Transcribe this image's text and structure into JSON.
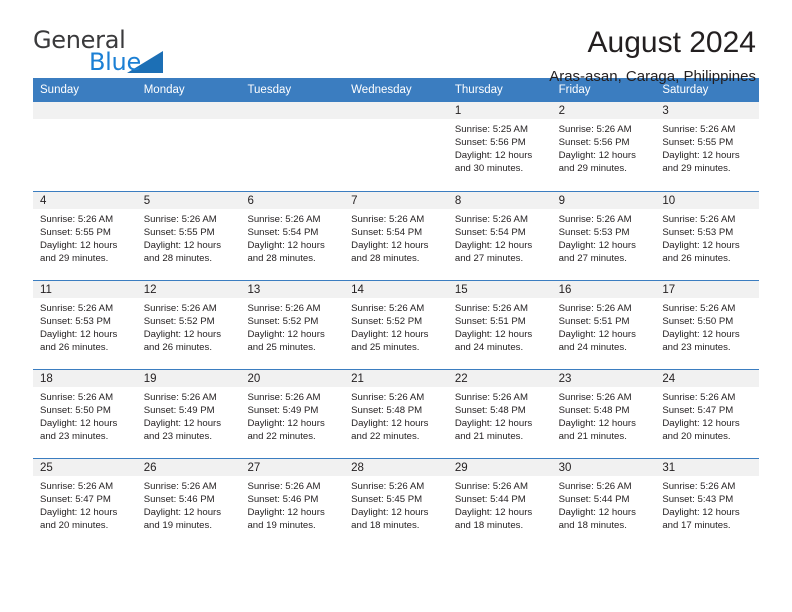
{
  "brand": {
    "name_part1": "General",
    "name_part2": "Blue",
    "triangle_icon": "brand-triangle-icon",
    "accent_color": "#1b7fd4",
    "header_color": "#3b7dc0"
  },
  "header": {
    "title": "August 2024",
    "subtitle": "Aras-asan, Caraga, Philippines"
  },
  "weekdays": [
    "Sunday",
    "Monday",
    "Tuesday",
    "Wednesday",
    "Thursday",
    "Friday",
    "Saturday"
  ],
  "labels": {
    "sunrise_prefix": "Sunrise:",
    "sunset_prefix": "Sunset:",
    "daylight_prefix": "Daylight:"
  },
  "weeks": [
    [
      {
        "day": "",
        "empty": true
      },
      {
        "day": "",
        "empty": true
      },
      {
        "day": "",
        "empty": true
      },
      {
        "day": "",
        "empty": true
      },
      {
        "day": "1",
        "sunrise": "Sunrise: 5:25 AM",
        "sunset": "Sunset: 5:56 PM",
        "daylight": "Daylight: 12 hours and 30 minutes."
      },
      {
        "day": "2",
        "sunrise": "Sunrise: 5:26 AM",
        "sunset": "Sunset: 5:56 PM",
        "daylight": "Daylight: 12 hours and 29 minutes."
      },
      {
        "day": "3",
        "sunrise": "Sunrise: 5:26 AM",
        "sunset": "Sunset: 5:55 PM",
        "daylight": "Daylight: 12 hours and 29 minutes."
      }
    ],
    [
      {
        "day": "4",
        "sunrise": "Sunrise: 5:26 AM",
        "sunset": "Sunset: 5:55 PM",
        "daylight": "Daylight: 12 hours and 29 minutes."
      },
      {
        "day": "5",
        "sunrise": "Sunrise: 5:26 AM",
        "sunset": "Sunset: 5:55 PM",
        "daylight": "Daylight: 12 hours and 28 minutes."
      },
      {
        "day": "6",
        "sunrise": "Sunrise: 5:26 AM",
        "sunset": "Sunset: 5:54 PM",
        "daylight": "Daylight: 12 hours and 28 minutes."
      },
      {
        "day": "7",
        "sunrise": "Sunrise: 5:26 AM",
        "sunset": "Sunset: 5:54 PM",
        "daylight": "Daylight: 12 hours and 28 minutes."
      },
      {
        "day": "8",
        "sunrise": "Sunrise: 5:26 AM",
        "sunset": "Sunset: 5:54 PM",
        "daylight": "Daylight: 12 hours and 27 minutes."
      },
      {
        "day": "9",
        "sunrise": "Sunrise: 5:26 AM",
        "sunset": "Sunset: 5:53 PM",
        "daylight": "Daylight: 12 hours and 27 minutes."
      },
      {
        "day": "10",
        "sunrise": "Sunrise: 5:26 AM",
        "sunset": "Sunset: 5:53 PM",
        "daylight": "Daylight: 12 hours and 26 minutes."
      }
    ],
    [
      {
        "day": "11",
        "sunrise": "Sunrise: 5:26 AM",
        "sunset": "Sunset: 5:53 PM",
        "daylight": "Daylight: 12 hours and 26 minutes."
      },
      {
        "day": "12",
        "sunrise": "Sunrise: 5:26 AM",
        "sunset": "Sunset: 5:52 PM",
        "daylight": "Daylight: 12 hours and 26 minutes."
      },
      {
        "day": "13",
        "sunrise": "Sunrise: 5:26 AM",
        "sunset": "Sunset: 5:52 PM",
        "daylight": "Daylight: 12 hours and 25 minutes."
      },
      {
        "day": "14",
        "sunrise": "Sunrise: 5:26 AM",
        "sunset": "Sunset: 5:52 PM",
        "daylight": "Daylight: 12 hours and 25 minutes."
      },
      {
        "day": "15",
        "sunrise": "Sunrise: 5:26 AM",
        "sunset": "Sunset: 5:51 PM",
        "daylight": "Daylight: 12 hours and 24 minutes."
      },
      {
        "day": "16",
        "sunrise": "Sunrise: 5:26 AM",
        "sunset": "Sunset: 5:51 PM",
        "daylight": "Daylight: 12 hours and 24 minutes."
      },
      {
        "day": "17",
        "sunrise": "Sunrise: 5:26 AM",
        "sunset": "Sunset: 5:50 PM",
        "daylight": "Daylight: 12 hours and 23 minutes."
      }
    ],
    [
      {
        "day": "18",
        "sunrise": "Sunrise: 5:26 AM",
        "sunset": "Sunset: 5:50 PM",
        "daylight": "Daylight: 12 hours and 23 minutes."
      },
      {
        "day": "19",
        "sunrise": "Sunrise: 5:26 AM",
        "sunset": "Sunset: 5:49 PM",
        "daylight": "Daylight: 12 hours and 23 minutes."
      },
      {
        "day": "20",
        "sunrise": "Sunrise: 5:26 AM",
        "sunset": "Sunset: 5:49 PM",
        "daylight": "Daylight: 12 hours and 22 minutes."
      },
      {
        "day": "21",
        "sunrise": "Sunrise: 5:26 AM",
        "sunset": "Sunset: 5:48 PM",
        "daylight": "Daylight: 12 hours and 22 minutes."
      },
      {
        "day": "22",
        "sunrise": "Sunrise: 5:26 AM",
        "sunset": "Sunset: 5:48 PM",
        "daylight": "Daylight: 12 hours and 21 minutes."
      },
      {
        "day": "23",
        "sunrise": "Sunrise: 5:26 AM",
        "sunset": "Sunset: 5:48 PM",
        "daylight": "Daylight: 12 hours and 21 minutes."
      },
      {
        "day": "24",
        "sunrise": "Sunrise: 5:26 AM",
        "sunset": "Sunset: 5:47 PM",
        "daylight": "Daylight: 12 hours and 20 minutes."
      }
    ],
    [
      {
        "day": "25",
        "sunrise": "Sunrise: 5:26 AM",
        "sunset": "Sunset: 5:47 PM",
        "daylight": "Daylight: 12 hours and 20 minutes."
      },
      {
        "day": "26",
        "sunrise": "Sunrise: 5:26 AM",
        "sunset": "Sunset: 5:46 PM",
        "daylight": "Daylight: 12 hours and 19 minutes."
      },
      {
        "day": "27",
        "sunrise": "Sunrise: 5:26 AM",
        "sunset": "Sunset: 5:46 PM",
        "daylight": "Daylight: 12 hours and 19 minutes."
      },
      {
        "day": "28",
        "sunrise": "Sunrise: 5:26 AM",
        "sunset": "Sunset: 5:45 PM",
        "daylight": "Daylight: 12 hours and 18 minutes."
      },
      {
        "day": "29",
        "sunrise": "Sunrise: 5:26 AM",
        "sunset": "Sunset: 5:44 PM",
        "daylight": "Daylight: 12 hours and 18 minutes."
      },
      {
        "day": "30",
        "sunrise": "Sunrise: 5:26 AM",
        "sunset": "Sunset: 5:44 PM",
        "daylight": "Daylight: 12 hours and 18 minutes."
      },
      {
        "day": "31",
        "sunrise": "Sunrise: 5:26 AM",
        "sunset": "Sunset: 5:43 PM",
        "daylight": "Daylight: 12 hours and 17 minutes."
      }
    ]
  ]
}
